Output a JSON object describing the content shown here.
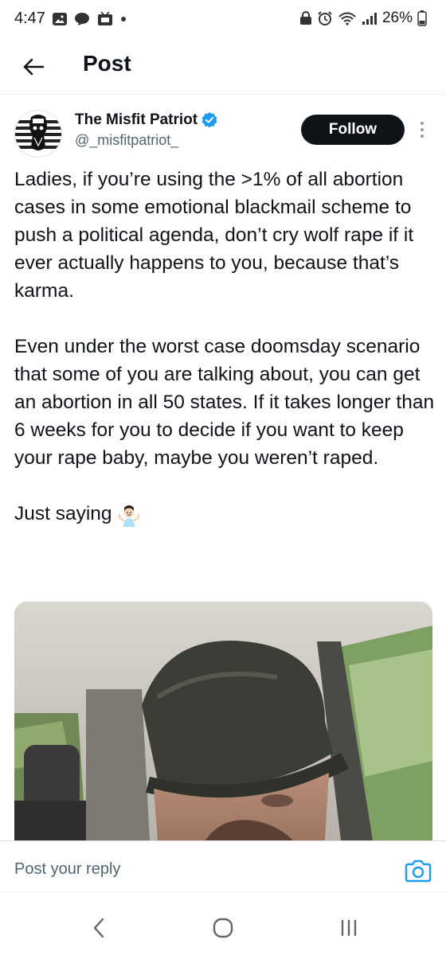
{
  "status_bar": {
    "time": "4:47",
    "battery": "26%"
  },
  "header": {
    "title": "Post"
  },
  "author": {
    "display_name": "The Misfit Patriot",
    "handle": "@_misfitpatriot_",
    "verified": true,
    "follow_label": "Follow"
  },
  "post": {
    "paragraphs": [
      "Ladies, if you’re using the >1% of all abortion cases in some emotional blackmail scheme to push a political agenda, don’t cry wolf rape if it ever actually happens to you, because that’s karma.",
      "Even under the worst case doomsday scenario that some of you are talking about, you can get an abortion in all 50 states. If it takes longer than 6 weeks for you to decide if you want to keep your rape baby, maybe you weren’t raped.",
      "Just saying"
    ],
    "emoji": "person-shrugging-icon"
  },
  "reply": {
    "placeholder": "Post your reply"
  },
  "colors": {
    "accent": "#1d9bf0",
    "text": "#0f1419",
    "secondary": "#536471",
    "follow_bg": "#0f1419"
  }
}
